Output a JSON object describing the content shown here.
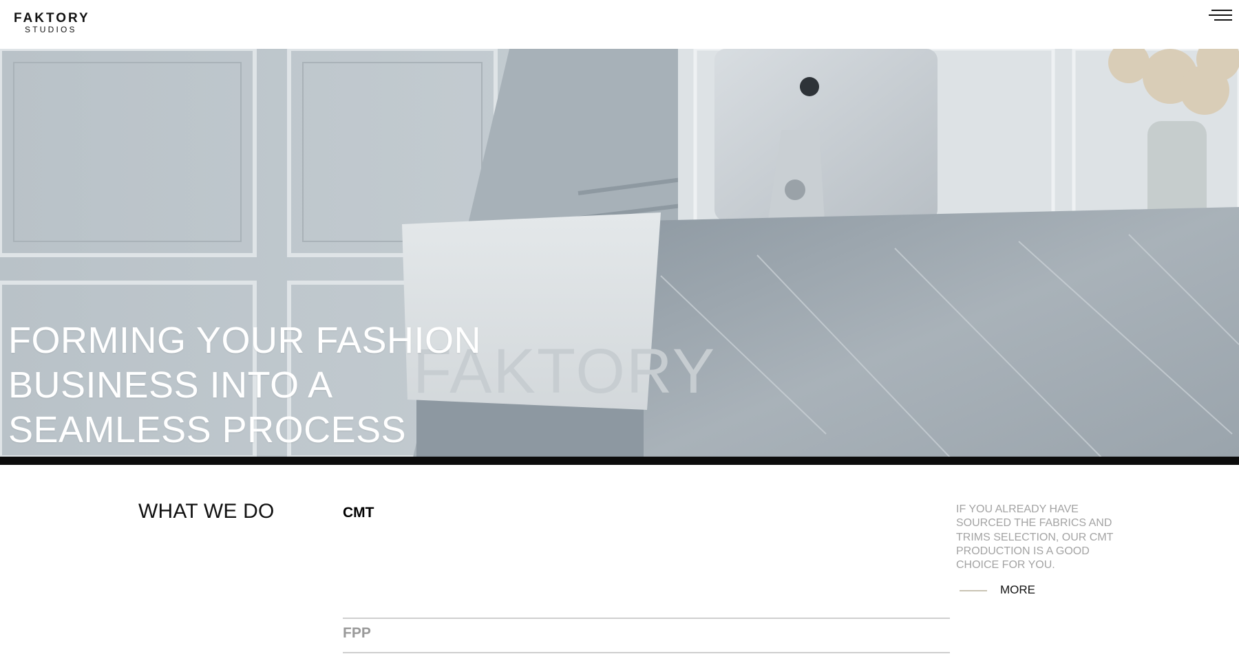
{
  "header": {
    "logo_top": "FAKTORY",
    "logo_bottom": "STUDIOS",
    "menu_icon": "hamburger-menu-icon"
  },
  "hero": {
    "title_lines": [
      "FORMING YOUR FASHION",
      "BUSINESS INTO A",
      "SEAMLESS PROCESS"
    ],
    "image_description_icon": "reception-desk-photo",
    "sign_text": "FAKTORY"
  },
  "what_we_do": {
    "title": "WHAT WE DO",
    "services": [
      {
        "label": "CMT",
        "active": true
      },
      {
        "label": "FPP",
        "active": false
      }
    ],
    "description": "IF YOU ALREADY HAVE SOURCED THE FABRICS AND TRIMS SELECTION, OUR CMT PRODUCTION IS A GOOD CHOICE FOR YOU.",
    "more_label": "MORE"
  },
  "colors": {
    "text": "#111111",
    "muted": "#a3a3a3",
    "accent_line": "#c9c3b3",
    "divider": "#cfcfcf"
  }
}
